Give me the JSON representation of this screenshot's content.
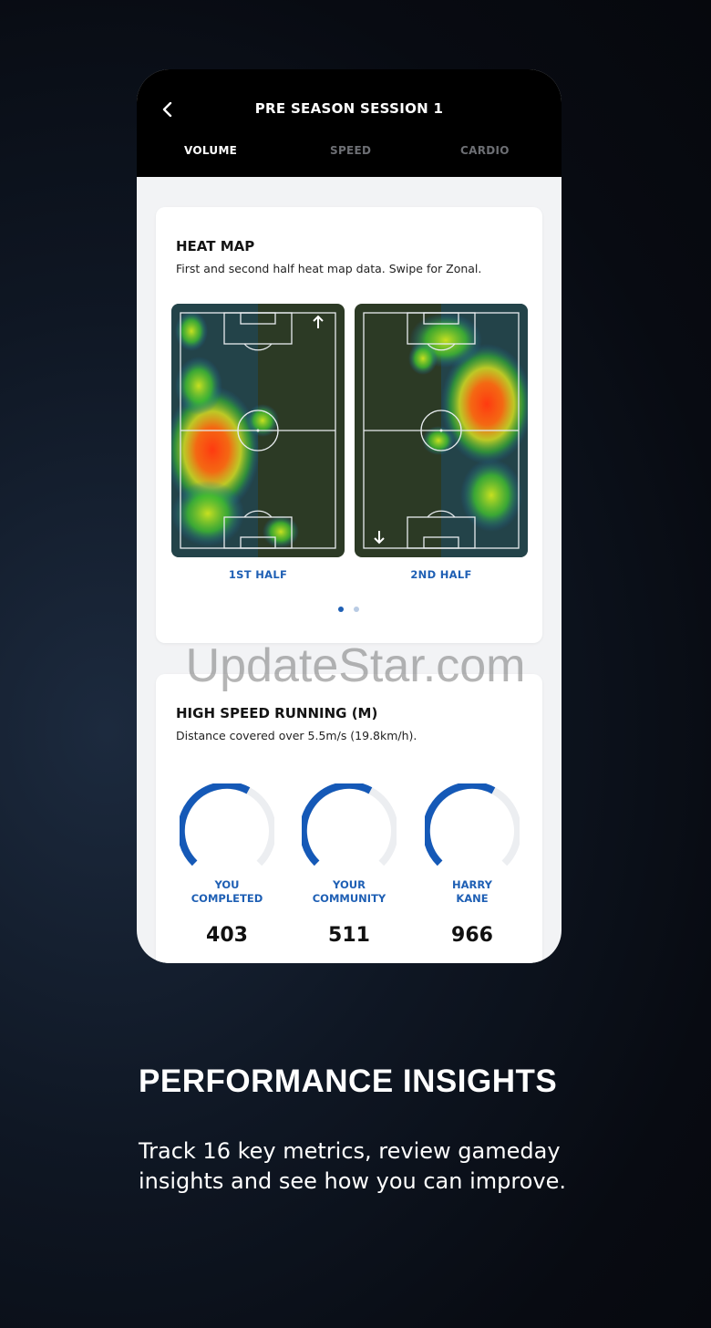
{
  "header": {
    "title": "PRE SEASON SESSION 1",
    "tabs": [
      {
        "label": "VOLUME",
        "active": true
      },
      {
        "label": "SPEED",
        "active": false
      },
      {
        "label": "CARDIO",
        "active": false
      }
    ]
  },
  "heatmap_card": {
    "title": "HEAT MAP",
    "subtitle": "First and second half heat map data. Swipe for Zonal.",
    "halves": [
      {
        "label": "1ST HALF",
        "arrow": "up-arrow-icon"
      },
      {
        "label": "2ND HALF",
        "arrow": "down-arrow-icon"
      }
    ],
    "pagination": {
      "current": 1,
      "total": 2
    }
  },
  "hsr_card": {
    "title": "HIGH SPEED RUNNING (M)",
    "subtitle": "Distance covered over 5.5m/s (19.8km/h).",
    "gauges": [
      {
        "label": "YOU\nCOMPLETED",
        "value": "403"
      },
      {
        "label": "YOUR\nCOMMUNITY",
        "value": "511"
      },
      {
        "label": "HARRY\nKANE",
        "value": "966"
      }
    ]
  },
  "watermark": "UpdateStar.com",
  "promo": {
    "headline": "PERFORMANCE INSIGHTS",
    "body": "Track 16 key metrics, review gameday insights and see how you can improve."
  },
  "colors": {
    "accent": "#1e5fb4",
    "gauge_arc": "#1559b7",
    "gauge_track": "#eceef1",
    "pitch_grass": "#2c3a25"
  }
}
